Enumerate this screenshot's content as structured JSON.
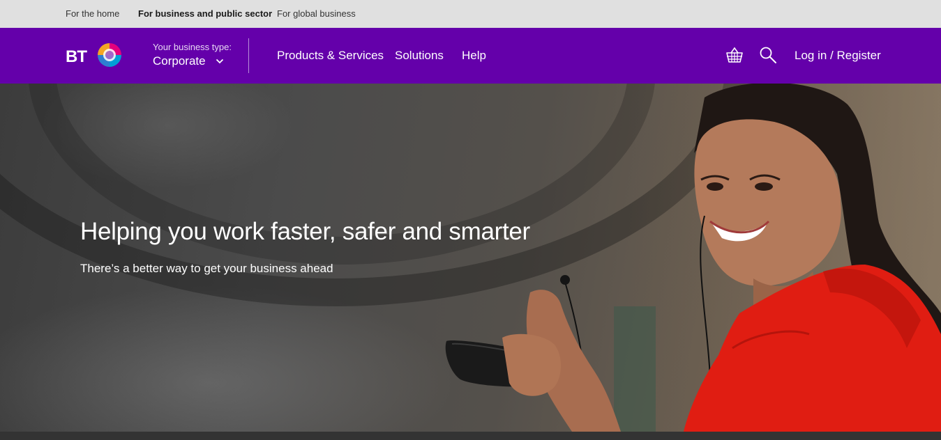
{
  "topbar": {
    "links": [
      {
        "label": "For the home",
        "active": false
      },
      {
        "label": "For business and public sector",
        "active": true
      },
      {
        "label": "For global business",
        "active": false
      }
    ]
  },
  "nav": {
    "logo_text": "BT",
    "business_type_label": "Your business type:",
    "business_type_value": "Corporate",
    "menu": [
      "Products & Services",
      "Solutions",
      "Help"
    ],
    "basket_icon": "basket-icon",
    "search_icon": "search-icon",
    "login_label": "Log in / Register"
  },
  "hero": {
    "title": "Helping you work faster, safer and smarter",
    "subtitle": "There’s a better way to get your business ahead"
  },
  "colors": {
    "brand_purple": "#6400aa",
    "topbar_bg": "#e0e0e0",
    "jacket_red": "#e01d12"
  }
}
